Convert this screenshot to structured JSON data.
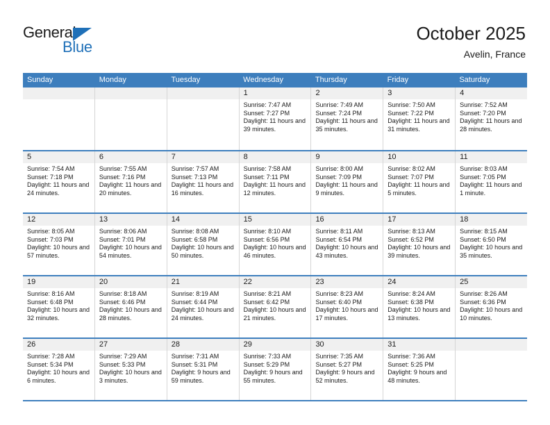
{
  "logo": {
    "word_general": "General",
    "word_blue": "Blue",
    "accent_color": "#1f70b8"
  },
  "header": {
    "title": "October 2025",
    "location": "Avelin, France"
  },
  "calendar": {
    "header_bg_color": "#3d7ebd",
    "day_header_bg_color": "#f0f0f0",
    "weekdays": [
      "Sunday",
      "Monday",
      "Tuesday",
      "Wednesday",
      "Thursday",
      "Friday",
      "Saturday"
    ],
    "weeks": [
      [
        {
          "day": "",
          "sunrise": "",
          "sunset": "",
          "daylight": "",
          "empty": true
        },
        {
          "day": "",
          "sunrise": "",
          "sunset": "",
          "daylight": "",
          "empty": true
        },
        {
          "day": "",
          "sunrise": "",
          "sunset": "",
          "daylight": "",
          "empty": true
        },
        {
          "day": "1",
          "sunrise": "Sunrise: 7:47 AM",
          "sunset": "Sunset: 7:27 PM",
          "daylight": "Daylight: 11 hours and 39 minutes."
        },
        {
          "day": "2",
          "sunrise": "Sunrise: 7:49 AM",
          "sunset": "Sunset: 7:24 PM",
          "daylight": "Daylight: 11 hours and 35 minutes."
        },
        {
          "day": "3",
          "sunrise": "Sunrise: 7:50 AM",
          "sunset": "Sunset: 7:22 PM",
          "daylight": "Daylight: 11 hours and 31 minutes."
        },
        {
          "day": "4",
          "sunrise": "Sunrise: 7:52 AM",
          "sunset": "Sunset: 7:20 PM",
          "daylight": "Daylight: 11 hours and 28 minutes."
        }
      ],
      [
        {
          "day": "5",
          "sunrise": "Sunrise: 7:54 AM",
          "sunset": "Sunset: 7:18 PM",
          "daylight": "Daylight: 11 hours and 24 minutes."
        },
        {
          "day": "6",
          "sunrise": "Sunrise: 7:55 AM",
          "sunset": "Sunset: 7:16 PM",
          "daylight": "Daylight: 11 hours and 20 minutes."
        },
        {
          "day": "7",
          "sunrise": "Sunrise: 7:57 AM",
          "sunset": "Sunset: 7:13 PM",
          "daylight": "Daylight: 11 hours and 16 minutes."
        },
        {
          "day": "8",
          "sunrise": "Sunrise: 7:58 AM",
          "sunset": "Sunset: 7:11 PM",
          "daylight": "Daylight: 11 hours and 12 minutes."
        },
        {
          "day": "9",
          "sunrise": "Sunrise: 8:00 AM",
          "sunset": "Sunset: 7:09 PM",
          "daylight": "Daylight: 11 hours and 9 minutes."
        },
        {
          "day": "10",
          "sunrise": "Sunrise: 8:02 AM",
          "sunset": "Sunset: 7:07 PM",
          "daylight": "Daylight: 11 hours and 5 minutes."
        },
        {
          "day": "11",
          "sunrise": "Sunrise: 8:03 AM",
          "sunset": "Sunset: 7:05 PM",
          "daylight": "Daylight: 11 hours and 1 minute."
        }
      ],
      [
        {
          "day": "12",
          "sunrise": "Sunrise: 8:05 AM",
          "sunset": "Sunset: 7:03 PM",
          "daylight": "Daylight: 10 hours and 57 minutes."
        },
        {
          "day": "13",
          "sunrise": "Sunrise: 8:06 AM",
          "sunset": "Sunset: 7:01 PM",
          "daylight": "Daylight: 10 hours and 54 minutes."
        },
        {
          "day": "14",
          "sunrise": "Sunrise: 8:08 AM",
          "sunset": "Sunset: 6:58 PM",
          "daylight": "Daylight: 10 hours and 50 minutes."
        },
        {
          "day": "15",
          "sunrise": "Sunrise: 8:10 AM",
          "sunset": "Sunset: 6:56 PM",
          "daylight": "Daylight: 10 hours and 46 minutes."
        },
        {
          "day": "16",
          "sunrise": "Sunrise: 8:11 AM",
          "sunset": "Sunset: 6:54 PM",
          "daylight": "Daylight: 10 hours and 43 minutes."
        },
        {
          "day": "17",
          "sunrise": "Sunrise: 8:13 AM",
          "sunset": "Sunset: 6:52 PM",
          "daylight": "Daylight: 10 hours and 39 minutes."
        },
        {
          "day": "18",
          "sunrise": "Sunrise: 8:15 AM",
          "sunset": "Sunset: 6:50 PM",
          "daylight": "Daylight: 10 hours and 35 minutes."
        }
      ],
      [
        {
          "day": "19",
          "sunrise": "Sunrise: 8:16 AM",
          "sunset": "Sunset: 6:48 PM",
          "daylight": "Daylight: 10 hours and 32 minutes."
        },
        {
          "day": "20",
          "sunrise": "Sunrise: 8:18 AM",
          "sunset": "Sunset: 6:46 PM",
          "daylight": "Daylight: 10 hours and 28 minutes."
        },
        {
          "day": "21",
          "sunrise": "Sunrise: 8:19 AM",
          "sunset": "Sunset: 6:44 PM",
          "daylight": "Daylight: 10 hours and 24 minutes."
        },
        {
          "day": "22",
          "sunrise": "Sunrise: 8:21 AM",
          "sunset": "Sunset: 6:42 PM",
          "daylight": "Daylight: 10 hours and 21 minutes."
        },
        {
          "day": "23",
          "sunrise": "Sunrise: 8:23 AM",
          "sunset": "Sunset: 6:40 PM",
          "daylight": "Daylight: 10 hours and 17 minutes."
        },
        {
          "day": "24",
          "sunrise": "Sunrise: 8:24 AM",
          "sunset": "Sunset: 6:38 PM",
          "daylight": "Daylight: 10 hours and 13 minutes."
        },
        {
          "day": "25",
          "sunrise": "Sunrise: 8:26 AM",
          "sunset": "Sunset: 6:36 PM",
          "daylight": "Daylight: 10 hours and 10 minutes."
        }
      ],
      [
        {
          "day": "26",
          "sunrise": "Sunrise: 7:28 AM",
          "sunset": "Sunset: 5:34 PM",
          "daylight": "Daylight: 10 hours and 6 minutes."
        },
        {
          "day": "27",
          "sunrise": "Sunrise: 7:29 AM",
          "sunset": "Sunset: 5:33 PM",
          "daylight": "Daylight: 10 hours and 3 minutes."
        },
        {
          "day": "28",
          "sunrise": "Sunrise: 7:31 AM",
          "sunset": "Sunset: 5:31 PM",
          "daylight": "Daylight: 9 hours and 59 minutes."
        },
        {
          "day": "29",
          "sunrise": "Sunrise: 7:33 AM",
          "sunset": "Sunset: 5:29 PM",
          "daylight": "Daylight: 9 hours and 55 minutes."
        },
        {
          "day": "30",
          "sunrise": "Sunrise: 7:35 AM",
          "sunset": "Sunset: 5:27 PM",
          "daylight": "Daylight: 9 hours and 52 minutes."
        },
        {
          "day": "31",
          "sunrise": "Sunrise: 7:36 AM",
          "sunset": "Sunset: 5:25 PM",
          "daylight": "Daylight: 9 hours and 48 minutes."
        },
        {
          "day": "",
          "sunrise": "",
          "sunset": "",
          "daylight": "",
          "empty": true
        }
      ]
    ]
  }
}
